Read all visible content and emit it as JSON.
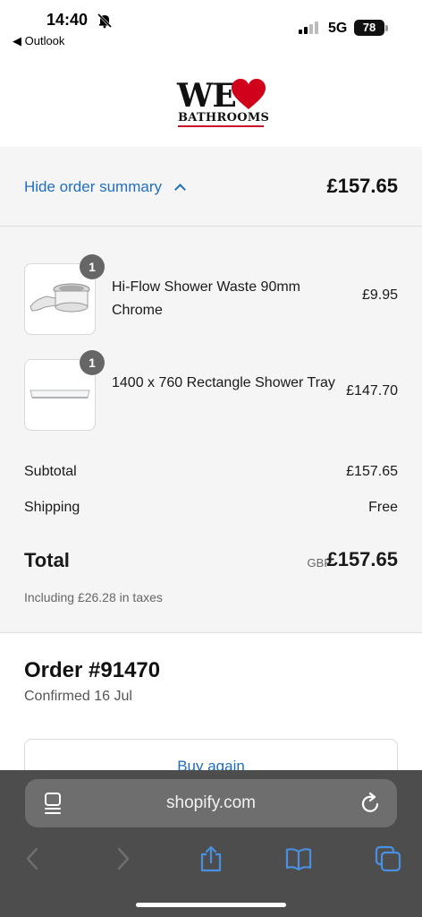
{
  "status": {
    "time": "14:40",
    "back_app": "◀ Outlook",
    "network": "5G",
    "battery": "78"
  },
  "brand": {
    "logo_word": "WE",
    "logo_sub": "BATHROOMS",
    "heart_color": "#d0021b"
  },
  "summary_toggle": {
    "label": "Hide order summary",
    "total": "£157.65"
  },
  "items": [
    {
      "qty": "1",
      "name": "Hi-Flow Shower Waste 90mm Chrome",
      "price": "£9.95",
      "thumb_icon": "shower-waste-thumb"
    },
    {
      "qty": "1",
      "name": "1400 x 760 Rectangle Shower Tray",
      "price": "£147.70",
      "thumb_icon": "shower-tray-thumb"
    }
  ],
  "totals": {
    "subtotal_label": "Subtotal",
    "subtotal": "£157.65",
    "shipping_label": "Shipping",
    "shipping": "Free",
    "total_label": "Total",
    "currency": "GBP",
    "total": "£157.65",
    "taxes": "Including £26.28 in taxes"
  },
  "order": {
    "title": "Order #91470",
    "confirmed": "Confirmed 16 Jul",
    "buy_again": "Buy again"
  },
  "browser": {
    "url": "shopify.com"
  },
  "colors": {
    "link": "#1f6fbf",
    "toolbar": "#4d4d4d",
    "toolbar_active": "#4a90e2"
  }
}
